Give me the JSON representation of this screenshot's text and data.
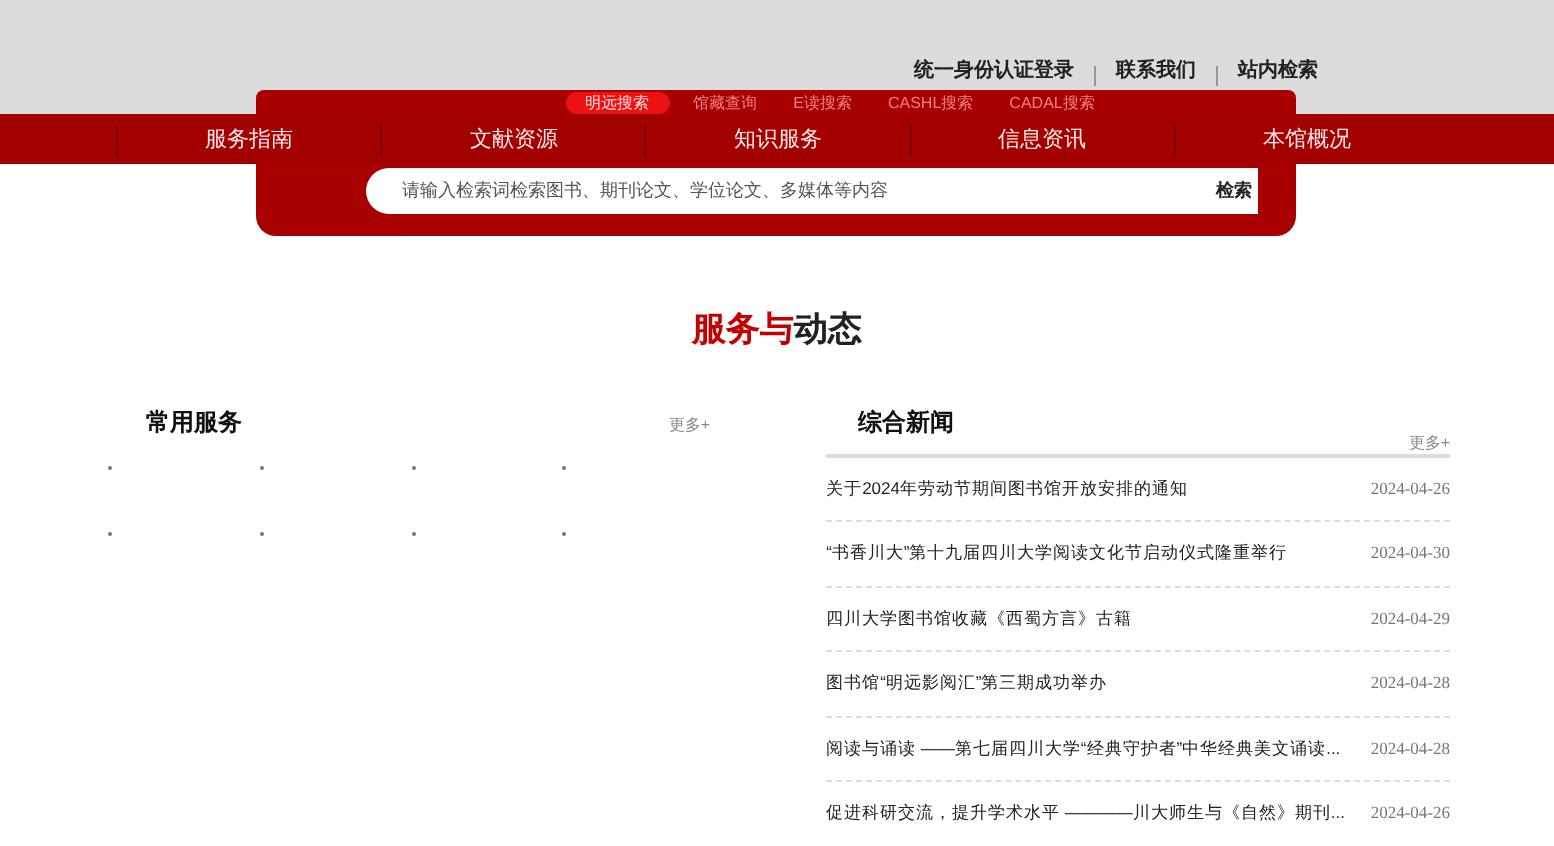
{
  "top_links": [
    "统一身份认证登录",
    "联系我们",
    "站内检索"
  ],
  "nav": [
    "服务指南",
    "文献资源",
    "知识服务",
    "信息资讯",
    "本馆概况"
  ],
  "search": {
    "tabs": [
      {
        "label": "明远搜索",
        "selected": true
      },
      {
        "label": "馆藏查询",
        "selected": false
      },
      {
        "label": "E读搜索",
        "selected": false
      },
      {
        "label": "CASHL搜索",
        "selected": false
      },
      {
        "label": "CADAL搜索",
        "selected": false
      }
    ],
    "placeholder": "请输入检索词检索图书、期刊论文、学位论文、多媒体等内容",
    "button": "检索"
  },
  "section_title": {
    "highlight": "服务与",
    "rest": "动态"
  },
  "services": {
    "title": "常用服务",
    "more": "更多+"
  },
  "news": {
    "title": "综合新闻",
    "more": "更多+",
    "items": [
      {
        "title": "关于2024年劳动节期间图书馆开放安排的通知",
        "date": "2024-04-26"
      },
      {
        "title": "“书香川大”第十九届四川大学阅读文化节启动仪式隆重举行",
        "date": "2024-04-30"
      },
      {
        "title": "四川大学图书馆收藏《西蜀方言》古籍",
        "date": "2024-04-29"
      },
      {
        "title": "图书馆“明远影阅汇”第三期成功举办",
        "date": "2024-04-28"
      },
      {
        "title": "阅读与诵读 ——第七届四川大学“经典守护者”中华经典美文诵读...",
        "date": "2024-04-28"
      },
      {
        "title": "促进科研交流，提升学术水平 ————川大师生与《自然》期刊...",
        "date": "2024-04-26"
      }
    ]
  }
}
